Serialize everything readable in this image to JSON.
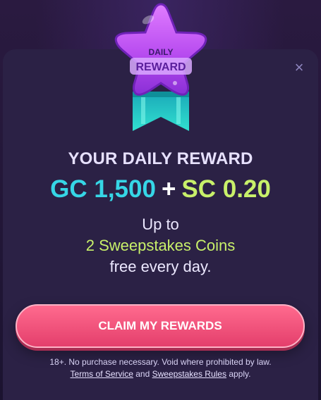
{
  "badge": {
    "line1": "DAILY",
    "line2": "REWARD"
  },
  "close": {
    "glyph": "×"
  },
  "reward": {
    "title": "YOUR DAILY REWARD",
    "gc_amount": "GC 1,500",
    "plus": "+",
    "sc_amount": "SC 0.20",
    "line1": "Up to",
    "line2": "2 Sweepstakes Coins",
    "line3": "free every day."
  },
  "cta": {
    "label": "CLAIM MY REWARDS"
  },
  "legal": {
    "text": "18+. No purchase necessary. Void where prohibited by law.",
    "terms_link": "Terms of Service",
    "and": "and",
    "rules_link": "Sweepstakes Rules",
    "apply": "apply."
  },
  "colors": {
    "modal_bg": "#2b2145",
    "gc": "#36d6e6",
    "sc": "#c8f06a",
    "cta": "#e43f6c",
    "star": "#b84cf0",
    "ribbon": "#20cfc4"
  }
}
